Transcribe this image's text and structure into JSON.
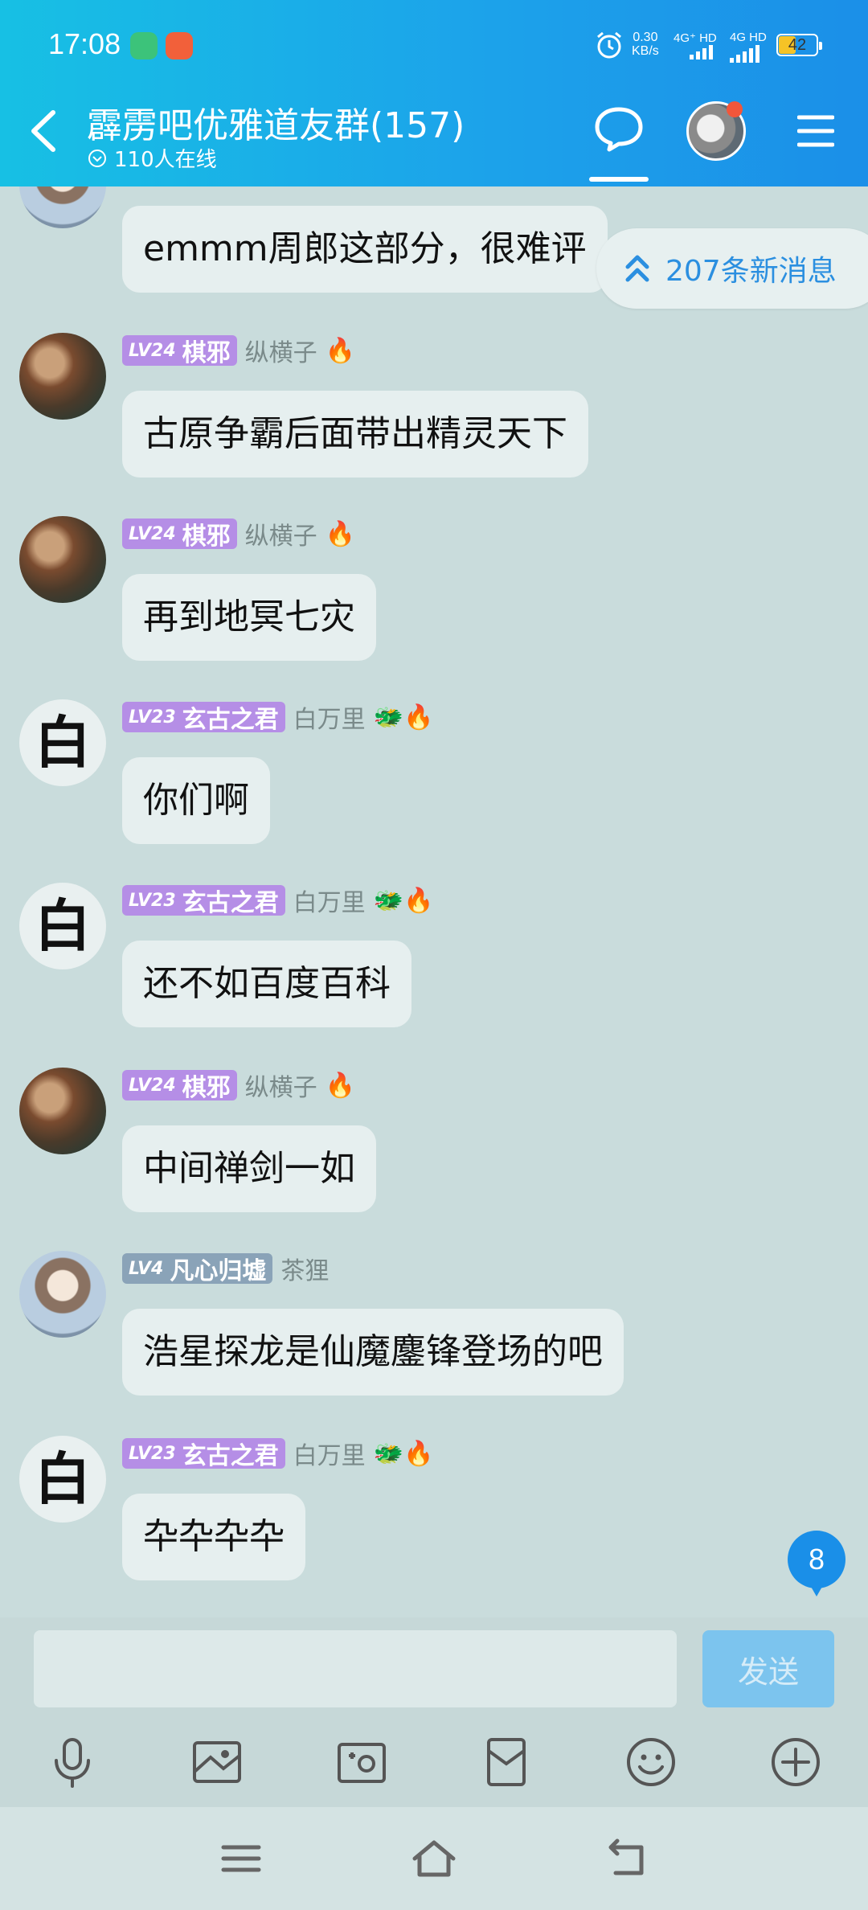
{
  "status_bar": {
    "time": "17:08",
    "speed_value": "0.30",
    "speed_unit": "KB/s",
    "net1": "4G⁺ HD",
    "net2": "4G HD",
    "battery": "42"
  },
  "header": {
    "title": "霹雳吧优雅道友群(157)",
    "online": "110人在线"
  },
  "new_messages": "207条新消息",
  "messages": [
    {
      "avatar": "boy",
      "text": "emmm周郎这部分，很难评"
    },
    {
      "avatar": "ink",
      "level": "LV24",
      "rank": "棋邪",
      "name": "纵横子",
      "badges": "🔥",
      "text": "古原争霸后面带出精灵天下"
    },
    {
      "avatar": "ink",
      "level": "LV24",
      "rank": "棋邪",
      "name": "纵横子",
      "badges": "🔥",
      "text": "再到地冥七灾"
    },
    {
      "avatar": "bai",
      "avatar_char": "白",
      "level": "LV23",
      "rank": "玄古之君",
      "name": "白万里",
      "badges": "🐲🔥",
      "text": "你们啊"
    },
    {
      "avatar": "bai",
      "avatar_char": "白",
      "level": "LV23",
      "rank": "玄古之君",
      "name": "白万里",
      "badges": "🐲🔥",
      "text": "还不如百度百科"
    },
    {
      "avatar": "ink",
      "level": "LV24",
      "rank": "棋邪",
      "name": "纵横子",
      "badges": "🔥",
      "text": "中间禅剑一如"
    },
    {
      "avatar": "boy",
      "level": "LV4",
      "rank": "凡心归墟",
      "name": "茶狸",
      "badges": "",
      "text": "浩星探龙是仙魔鏖锋登场的吧"
    },
    {
      "avatar": "bai",
      "avatar_char": "白",
      "level": "LV23",
      "rank": "玄古之君",
      "name": "白万里",
      "badges": "🐲🔥",
      "text": "卆卆卆卆"
    }
  ],
  "unread_count": "8",
  "composer": {
    "input_value": "",
    "send_label": "发送"
  },
  "toolbar_icons": [
    "microphone-icon",
    "image-icon",
    "camera-icon",
    "red-packet-icon",
    "emoji-icon",
    "plus-icon"
  ],
  "navbar_icons": [
    "menu-icon",
    "home-icon",
    "back-icon"
  ]
}
